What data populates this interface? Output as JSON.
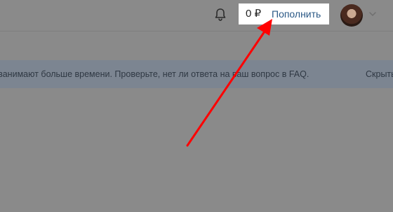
{
  "header": {
    "balance": "0 ₽",
    "topup_label": "Пополнить",
    "icons": {
      "bell": "bell-icon",
      "chevron": "chevron-down-icon"
    }
  },
  "notice": {
    "text": "занимают больше времени. Проверьте, нет ли ответа на ваш вопрос в FAQ.",
    "hide_label": "Скрыть"
  },
  "annotation": {
    "arrow_color": "#ff0000"
  },
  "colors": {
    "overlay": "#8a8a8a",
    "notice_bg": "#7c8591",
    "link": "#2a5885"
  }
}
